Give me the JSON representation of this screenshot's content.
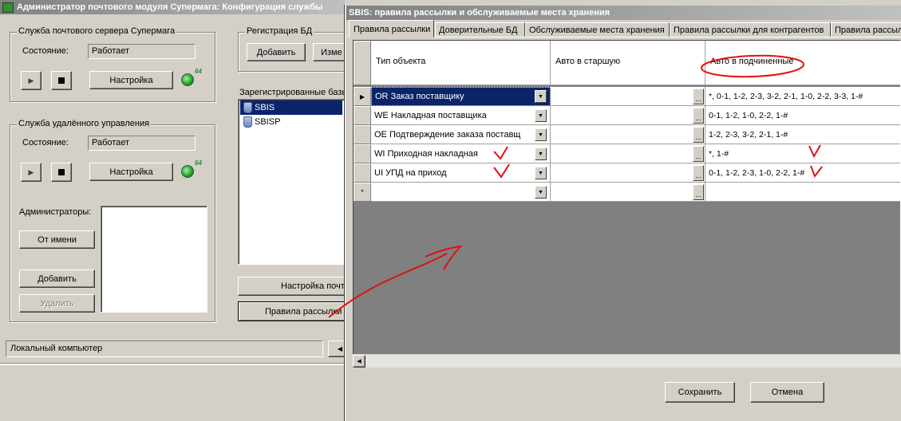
{
  "main_window": {
    "title": "Администратор почтового модуля Супермага: Конфигурация службы",
    "mail_server_group": {
      "label": "Служба почтового сервера Супермага",
      "status_label": "Состояние:",
      "status_value": "Работает",
      "settings_button": "Настройка",
      "led_tag": "64"
    },
    "remote_group": {
      "label": "Служба удалённого управления",
      "status_label": "Состояние:",
      "status_value": "Работает",
      "settings_button": "Настройка",
      "led_tag": "64",
      "admins_label": "Администраторы:",
      "as_user_button": "От имени",
      "add_button": "Добавить",
      "delete_button": "Удалить"
    },
    "db_registration": {
      "label": "Регистрация БД",
      "add_button": "Добавить",
      "edit_button": "Изме"
    },
    "registered_label": "Зарегистрированные базы",
    "registered_items": [
      "SBIS",
      "SBISP"
    ],
    "mail_settings_button": "Настройка почты",
    "mailing_rules_button": "Правила рассылки",
    "status_bar": "Локальный компьютер"
  },
  "dialog": {
    "title": "SBIS: правила рассылки и обслуживаемые места хранения",
    "tabs": [
      "Правила рассылки",
      "Доверительные БД",
      "Обслуживаемые места хранения",
      "Правила рассылки для контрагентов",
      "Правила рассылки"
    ],
    "columns": [
      "Тип объекта",
      "Авто в старшую",
      "Авто в подчиненные"
    ],
    "rows": [
      {
        "type": "OR  Заказ поставщику",
        "auto_up": "",
        "auto_down": "*, 0-1, 1-2, 2-3, 3-2, 2-1, 1-0, 2-2, 3-3, 1-#"
      },
      {
        "type": "WE  Накладная поставщика",
        "auto_up": "",
        "auto_down": "0-1, 1-2, 1-0, 2-2, 1-#"
      },
      {
        "type": "OE  Подтверждение заказа поставщ",
        "auto_up": "",
        "auto_down": "1-2, 2-3, 3-2, 2-1, 1-#"
      },
      {
        "type": "WI  Приходная накладная",
        "auto_up": "",
        "auto_down": "*, 1-#"
      },
      {
        "type": "UI  УПД на приход",
        "auto_up": "",
        "auto_down": "0-1, 1-2, 2-3, 1-0, 2-2, 1-#"
      },
      {
        "type": "",
        "auto_up": "",
        "auto_down": ""
      }
    ],
    "save_button": "Сохранить",
    "cancel_button": "Отмена"
  },
  "colors": {
    "titlebar_active_start": "#0a246a",
    "titlebar_active_end": "#a6caf0",
    "titlebar_inactive_start": "#808080",
    "titlebar_inactive_end": "#c0c0c0",
    "selection": "#0a246a",
    "annotation": "#e01010"
  }
}
